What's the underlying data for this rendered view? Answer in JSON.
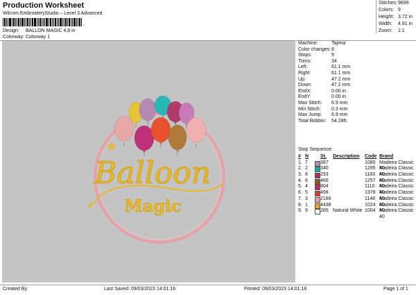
{
  "header": {
    "title": "Production Worksheet",
    "subtitle": "Wilcom EmbroideryStudio – Level 3 Advanced",
    "barcode_text": ",",
    "design_label": "Design:",
    "design_value": "BALLON MAGIC 4,8 in",
    "colorway_label": "Colorway:",
    "colorway_value": "Colorway 1"
  },
  "stats": [
    {
      "label": "Stitches:",
      "value": "9699"
    },
    {
      "label": "Colors:",
      "value": "9"
    },
    {
      "label": "Height:",
      "value": "3.72 in"
    },
    {
      "label": "Width:",
      "value": "4.81 in"
    },
    {
      "label": "Zoom:",
      "value": "1:1"
    }
  ],
  "design": {
    "text_main": "Balloon",
    "text_sub": "Magic",
    "colors": {
      "background": "#c4c4c4",
      "ring": "#e8a0a8",
      "gold": "#e8b828",
      "gold_dark": "#c99a1a"
    },
    "balloons": [
      {
        "color": "#e6c43a"
      },
      {
        "color": "#b48ab0"
      },
      {
        "color": "#28b8b8"
      },
      {
        "color": "#b13a6a"
      },
      {
        "color": "#c97ab8"
      },
      {
        "color": "#e8a8a8"
      },
      {
        "color": "#c0307a"
      },
      {
        "color": "#e85030"
      },
      {
        "color": "#b07a3a"
      },
      {
        "color": "#f0b0b0"
      }
    ]
  },
  "info": [
    {
      "label": "Machine:",
      "value": "Tajima"
    },
    {
      "label": "Color changes:",
      "value": "8"
    },
    {
      "label": "Stops:",
      "value": "9"
    },
    {
      "label": "Trims:",
      "value": "34"
    },
    {
      "label": "Left:",
      "value": "61.1 mm"
    },
    {
      "label": "Right:",
      "value": "61.1 mm"
    },
    {
      "label": "Up:",
      "value": "47.2 mm"
    },
    {
      "label": "Down:",
      "value": "47.2 mm"
    },
    {
      "label": "EndX:",
      "value": "0.00 in"
    },
    {
      "label": "EndY:",
      "value": "0.00 in"
    },
    {
      "label": "Max Stitch:",
      "value": "6.9 mm"
    },
    {
      "label": "Min Stitch:",
      "value": "0.3 mm"
    },
    {
      "label": "Max Jump:",
      "value": "6.9 mm"
    },
    {
      "label": "Total Bobbin:",
      "value": "54.28ft."
    }
  ],
  "sequence": {
    "title": "Stop Sequence:",
    "headers": [
      "#",
      "N",
      "St.",
      "Description",
      "Code",
      "Brand"
    ],
    "rows": [
      {
        "num": "1.",
        "n": "7",
        "color": "#b48ab0",
        "st": "387",
        "desc": "",
        "code": "1080",
        "brand": "Madeira Classic 40"
      },
      {
        "num": "2.",
        "n": "2",
        "color": "#1aa9b0",
        "st": "340",
        "desc": "",
        "code": "1295",
        "brand": "Madeira Classic 40"
      },
      {
        "num": "3.",
        "n": "8",
        "color": "#a8325a",
        "st": "293",
        "desc": "",
        "code": "1183",
        "brand": "Madeira Classic 40"
      },
      {
        "num": "4.",
        "n": "6",
        "color": "#8a5a2a",
        "st": "466",
        "desc": "",
        "code": "1257",
        "brand": "Madeira Classic 40"
      },
      {
        "num": "5.",
        "n": "4",
        "color": "#c02a6a",
        "st": "804",
        "desc": "",
        "code": "1110",
        "brand": "Madeira Classic 40"
      },
      {
        "num": "6.",
        "n": "5",
        "color": "#d83a3a",
        "st": "498",
        "desc": "",
        "code": "1378",
        "brand": "Madeira Classic 40"
      },
      {
        "num": "7.",
        "n": "3",
        "color": "#e8a0a8",
        "st": "2186",
        "desc": "",
        "code": "1148",
        "brand": "Madeira Classic 40"
      },
      {
        "num": "8.",
        "n": "1",
        "color": "#f0a030",
        "st": "4438",
        "desc": "",
        "code": "1024",
        "brand": "Madeira Classic 40"
      },
      {
        "num": "9.",
        "n": "9",
        "color": "#f4f4f4",
        "st": "285",
        "desc": "Natural White",
        "code": "1004",
        "brand": "Madeira Classic 40"
      }
    ]
  },
  "footer": {
    "created_by": "Created By:",
    "last_saved": "Last Saved: 09/03/2023 14:01:16",
    "printed": "Printed: 09/03/2023 14:01:18",
    "page": "Page 1 of 1"
  }
}
